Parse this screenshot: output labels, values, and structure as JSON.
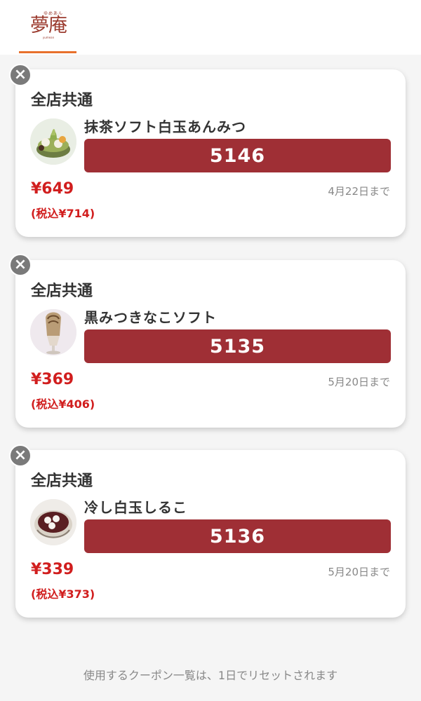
{
  "header": {
    "logo_ruby": "ゆめあん",
    "logo_text": "夢庵",
    "logo_sub": "yumean",
    "indicator_color": "#e8712c"
  },
  "coupons": [
    {
      "store": "全店共通",
      "item": "抹茶ソフト白玉あんみつ",
      "code": "5146",
      "price": "¥649",
      "tax_price": "(税込¥714)",
      "expiry": "4月22日まで",
      "image_icon": "matcha-anmitsu-image"
    },
    {
      "store": "全店共通",
      "item": "黒みつきなこソフト",
      "code": "5135",
      "price": "¥369",
      "tax_price": "(税込¥406)",
      "expiry": "5月20日まで",
      "image_icon": "kinako-soft-image"
    },
    {
      "store": "全店共通",
      "item": "冷し白玉しるこ",
      "code": "5136",
      "price": "¥339",
      "tax_price": "(税込¥373)",
      "expiry": "5月20日まで",
      "image_icon": "shiratama-shiruko-image"
    }
  ],
  "close_symbol": "×",
  "footer_note": "使用するクーポン一覧は、1日でリセットされます",
  "colors": {
    "code_bar": "#9f2f35",
    "price": "#d11e1e",
    "close_button": "#7a7a7a"
  }
}
